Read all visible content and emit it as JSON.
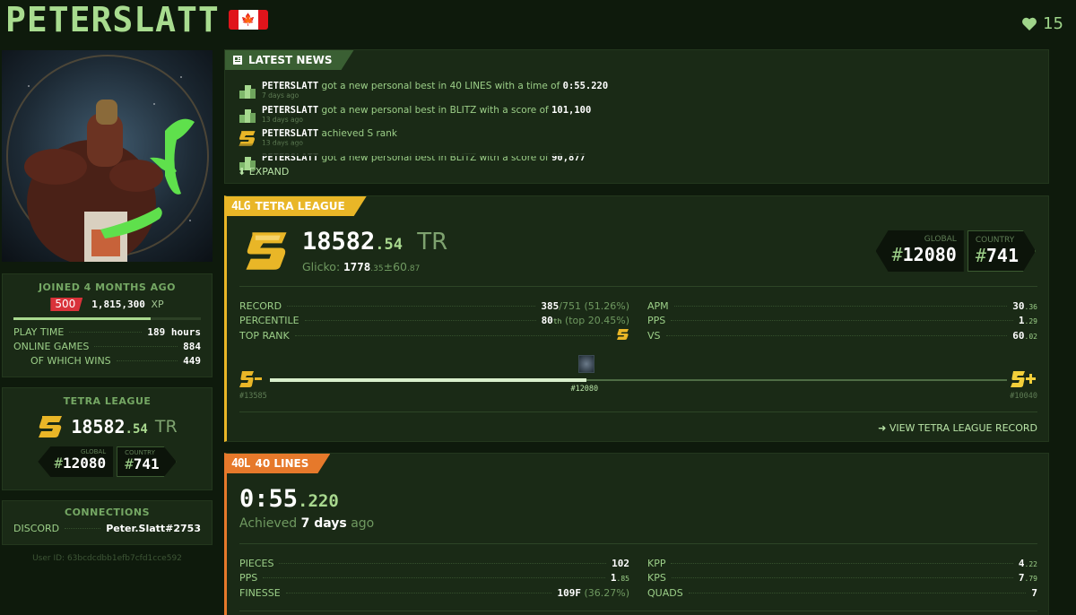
{
  "profile": {
    "username": "PETERSLATT",
    "supporters": "15",
    "joined": "JOINED 4 MONTHS AGO",
    "level": "500",
    "xp": "1,815,300",
    "xp_unit": "XP",
    "xp_progress": 0.73,
    "stats": [
      {
        "label": "PLAY TIME",
        "value": "189 hours"
      },
      {
        "label": "ONLINE GAMES",
        "value": "884"
      },
      {
        "label": "OF WHICH WINS",
        "value": "449"
      }
    ],
    "user_id": "User ID: 63bcdcdbb1efb7cfd1cce592"
  },
  "left_league": {
    "heading": "TETRA LEAGUE",
    "tr_int": "18582",
    "tr_dec": ".54",
    "tr_unit": "TR",
    "global_label": "GLOBAL",
    "global": "12080",
    "country_label": "COUNTRY",
    "country": "741"
  },
  "connections": {
    "heading": "CONNECTIONS",
    "service": "DISCORD",
    "handle": "Peter.Slatt#2753"
  },
  "news": {
    "title": "LATEST NEWS",
    "items": [
      {
        "user": "PETERSLATT",
        "mid": " got a new personal best in ",
        "mode": "40 LINES",
        "tail": " with a time of ",
        "value": "0:55.220",
        "ago": "7 days ago",
        "icon": "trophy-icon"
      },
      {
        "user": "PETERSLATT",
        "mid": " got a new personal best in ",
        "mode": "BLITZ",
        "tail": " with a score of ",
        "value": "101,100",
        "ago": "13 days ago",
        "icon": "trophy-icon"
      },
      {
        "user": "PETERSLATT",
        "mid": " achieved ",
        "mode": "S",
        "tail": " rank",
        "value": "",
        "ago": "13 days ago",
        "icon": "s-rank-icon"
      },
      {
        "user": "PETERSLATT",
        "mid": " got a new personal best in ",
        "mode": "BLITZ",
        "tail": " with a score of ",
        "value": "90,877",
        "ago": "",
        "icon": "trophy-icon"
      }
    ],
    "expand": "EXPAND"
  },
  "league": {
    "tag_code": "4LG",
    "title": "TETRA LEAGUE",
    "tr_int": "18582",
    "tr_dec": ".54",
    "tr_unit": "TR",
    "glicko_label": "Glicko:",
    "glicko_int": "1778",
    "glicko_dec": ".35",
    "rd_int": "±60",
    "rd_dec": ".87",
    "global_label": "GLOBAL",
    "global": "12080",
    "country_label": "COUNTRY",
    "country": "741",
    "left_stats": [
      {
        "label": "RECORD",
        "value": "385",
        "extra": "/751 (51.26%)"
      },
      {
        "label": "PERCENTILE",
        "value": "80",
        "sup": "th",
        "extra": " (top 20.45%)"
      },
      {
        "label": "TOP RANK",
        "value": "",
        "icon": "s-rank-icon"
      }
    ],
    "right_stats": [
      {
        "label": "APM",
        "int": "30",
        "dec": ".36"
      },
      {
        "label": "PPS",
        "int": "1",
        "dec": ".29"
      },
      {
        "label": "VS",
        "int": "60",
        "dec": ".02"
      }
    ],
    "prev_rank": "S-",
    "prev_rank_pos": "#13585",
    "next_rank": "S+",
    "next_rank_pos": "#10040",
    "my_pos": "#12080",
    "progress": 0.43,
    "view_record": "VIEW TETRA LEAGUE RECORD"
  },
  "sprint": {
    "tag_code": "40L",
    "title": "40 LINES",
    "time_int": "0:55",
    "time_dec": ".220",
    "achieved_pre": "Achieved ",
    "achieved_when": "7 days",
    "achieved_post": " ago",
    "left_stats": [
      {
        "label": "PIECES",
        "value": "102"
      },
      {
        "label": "PPS",
        "int": "1",
        "dec": ".85"
      },
      {
        "label": "FINESSE",
        "value": "109F",
        "extra": " (36.27%)"
      }
    ],
    "right_stats": [
      {
        "label": "KPP",
        "int": "4",
        "dec": ".22"
      },
      {
        "label": "KPS",
        "int": "7",
        "dec": ".79"
      },
      {
        "label": "QUADS",
        "value": "7"
      }
    ]
  },
  "colors": {
    "accent_green": "#a8dc8f",
    "league_gold": "#e9b627",
    "sprint_orange": "#e6792b",
    "level_red": "#d9323a"
  }
}
